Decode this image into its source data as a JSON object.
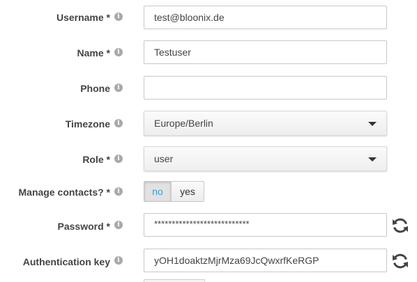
{
  "fields": {
    "username": {
      "label": "Username *",
      "value": "test@bloonix.de"
    },
    "name": {
      "label": "Name *",
      "value": "Testuser"
    },
    "phone": {
      "label": "Phone",
      "value": ""
    },
    "timezone": {
      "label": "Timezone",
      "value": "Europe/Berlin"
    },
    "role": {
      "label": "Role *",
      "value": "user"
    },
    "manage_contacts": {
      "label": "Manage contacts? *",
      "options": [
        "no",
        "yes"
      ],
      "selected": "no"
    },
    "password": {
      "label": "Password *",
      "value": "***************************"
    },
    "auth_key": {
      "label": "Authentication key",
      "value": "yOH1doaktzMjrMza69JcQwxrfKeRGP"
    }
  },
  "info_glyph": "i",
  "colors": {
    "label": "#444444",
    "info_icon": "#a9a9a9",
    "toggle_active_text": "#3a9fd6",
    "input_border": "#c8c8c8"
  },
  "icons": {
    "info": "info-circle-icon",
    "caret": "caret-down-icon",
    "refresh": "refresh-icon"
  }
}
